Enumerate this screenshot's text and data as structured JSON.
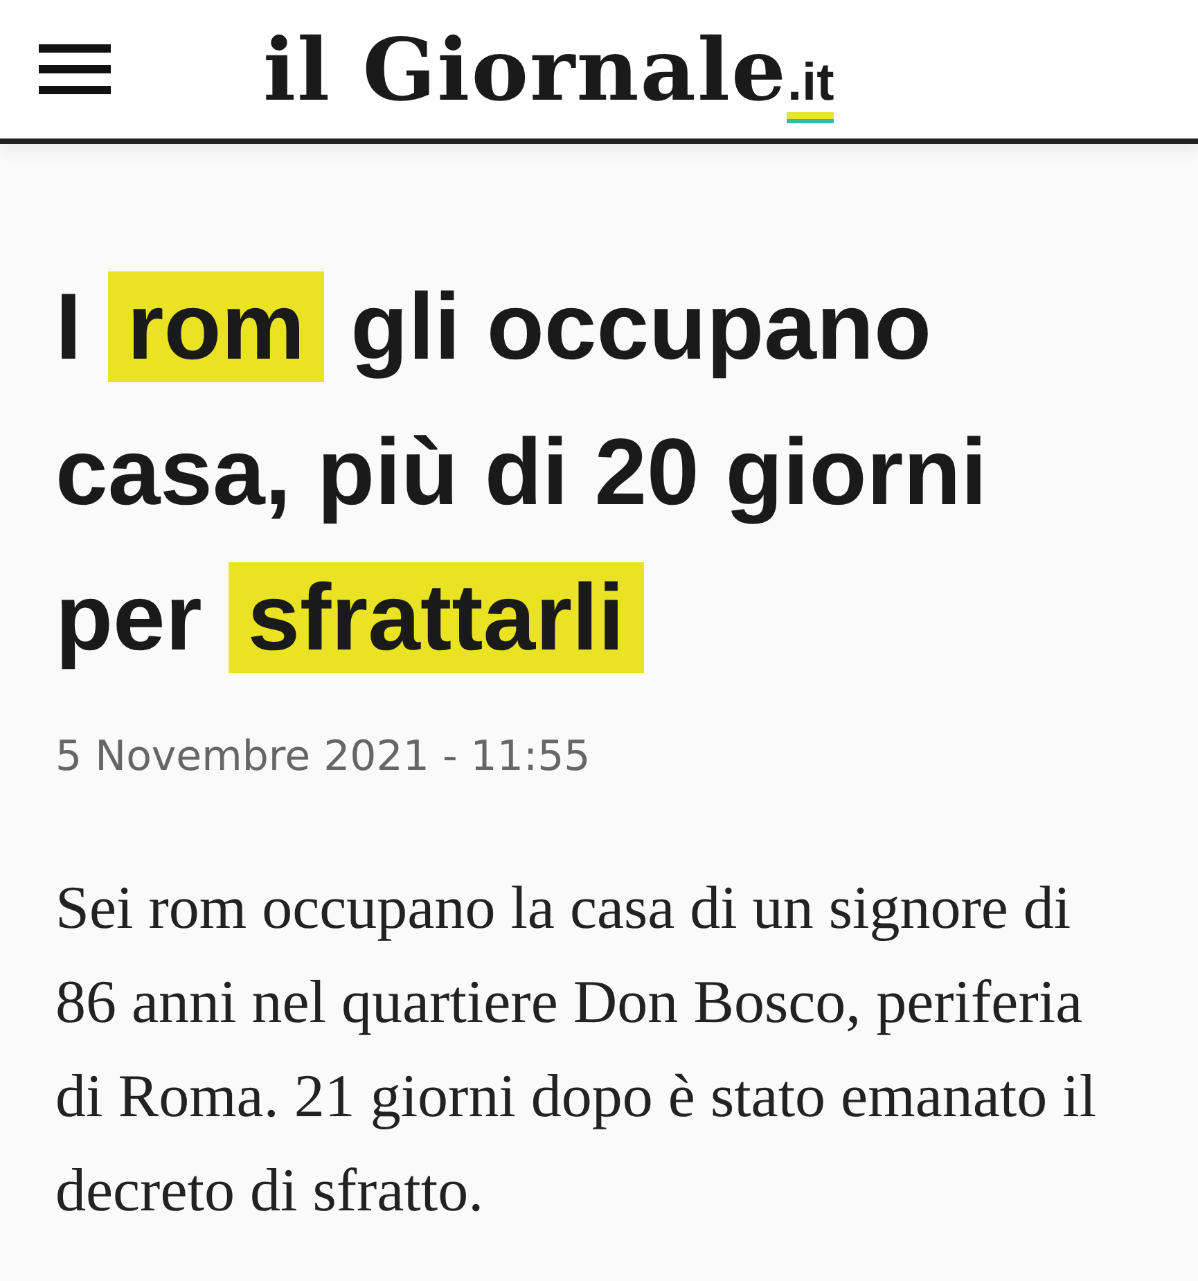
{
  "header": {
    "logo": {
      "name": "il Giornale",
      "suffix": ".it"
    }
  },
  "article": {
    "headline": [
      {
        "text": "I ",
        "highlighted": false
      },
      {
        "text": "rom",
        "highlighted": true
      },
      {
        "text": " gli occupano casa, più di 20 giorni per ",
        "highlighted": false
      },
      {
        "text": "sfrattarli",
        "highlighted": true
      }
    ],
    "date": "5 Novembre 2021 - 11:55",
    "body": "Sei rom occupano la casa di un signore di 86 anni nel quartiere Don Bosco, periferia di Roma. 21 giorni dopo è stato emanato il decreto di sfratto."
  }
}
